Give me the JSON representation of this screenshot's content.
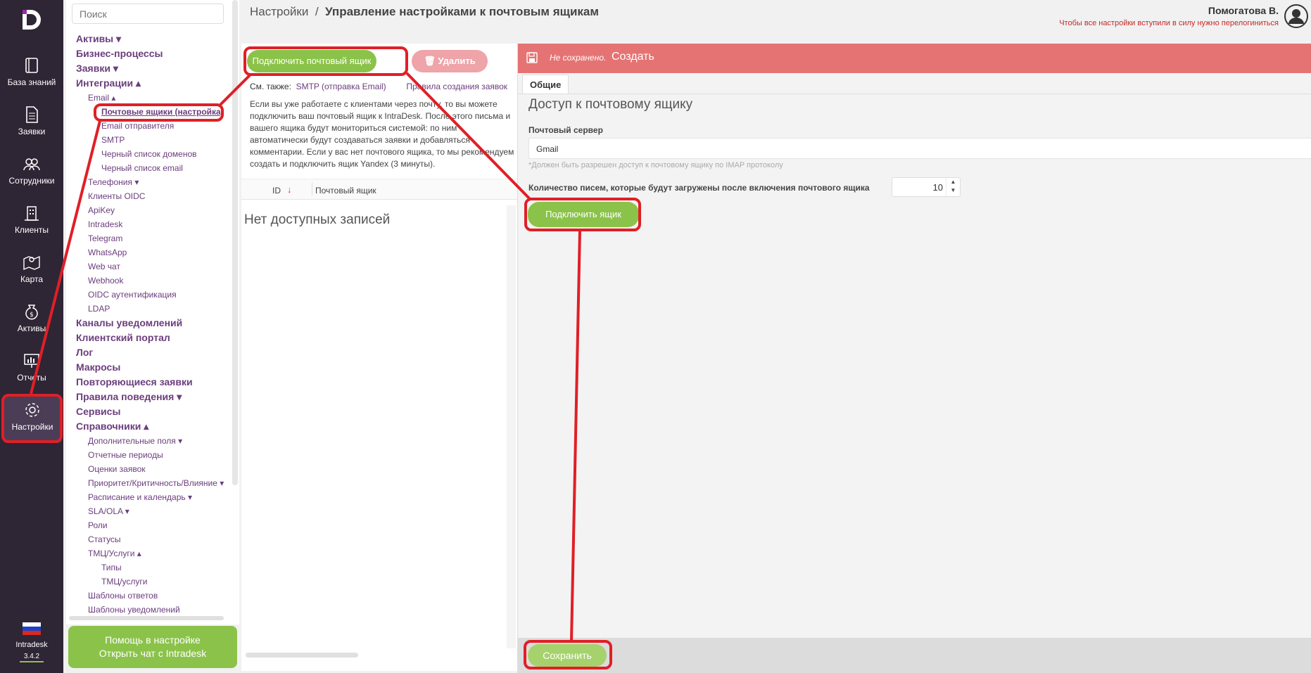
{
  "rail": {
    "items": [
      {
        "label": "База знаний",
        "icon": "book-icon"
      },
      {
        "label": "Заявки",
        "icon": "document-icon"
      },
      {
        "label": "Сотрудники",
        "icon": "users-icon"
      },
      {
        "label": "Клиенты",
        "icon": "building-icon"
      },
      {
        "label": "Карта",
        "icon": "map-icon"
      },
      {
        "label": "Активы",
        "icon": "money-bag-icon"
      },
      {
        "label": "Отчеты",
        "icon": "chart-icon"
      },
      {
        "label": "Настройки",
        "icon": "gear-icon"
      }
    ],
    "app_name": "Intradesk",
    "version": "3.4.2"
  },
  "nav": {
    "search_placeholder": "Поиск",
    "items": [
      {
        "label": "Активы ▾",
        "level": 1
      },
      {
        "label": "Бизнес-процессы",
        "level": 1
      },
      {
        "label": "Заявки ▾",
        "level": 1
      },
      {
        "label": "Интеграции ▴",
        "level": 1
      },
      {
        "label": "Email ▴",
        "level": 2
      },
      {
        "label": "Почтовые ящики (настройка)",
        "level": 3
      },
      {
        "label": "Email отправителя",
        "level": 3
      },
      {
        "label": "SMTP",
        "level": 3
      },
      {
        "label": "Черный список доменов",
        "level": 3
      },
      {
        "label": "Черный список email",
        "level": 3
      },
      {
        "label": "Телефония ▾",
        "level": 2
      },
      {
        "label": "Клиенты OIDC",
        "level": 2
      },
      {
        "label": "ApiKey",
        "level": 2
      },
      {
        "label": "Intradesk",
        "level": 2
      },
      {
        "label": "Telegram",
        "level": 2
      },
      {
        "label": "WhatsApp",
        "level": 2
      },
      {
        "label": "Web чат",
        "level": 2
      },
      {
        "label": "Webhook",
        "level": 2
      },
      {
        "label": "OIDC аутентификация",
        "level": 2
      },
      {
        "label": "LDAP",
        "level": 2
      },
      {
        "label": "Каналы уведомлений",
        "level": 1
      },
      {
        "label": "Клиентский портал",
        "level": 1
      },
      {
        "label": "Лог",
        "level": 1
      },
      {
        "label": "Макросы",
        "level": 1
      },
      {
        "label": "Повторяющиеся заявки",
        "level": 1
      },
      {
        "label": "Правила поведения ▾",
        "level": 1
      },
      {
        "label": "Сервисы",
        "level": 1
      },
      {
        "label": "Справочники ▴",
        "level": 1
      },
      {
        "label": "Дополнительные поля ▾",
        "level": 2
      },
      {
        "label": "Отчетные периоды",
        "level": 2
      },
      {
        "label": "Оценки заявок",
        "level": 2
      },
      {
        "label": "Приоритет/Критичность/Влияние ▾",
        "level": 2
      },
      {
        "label": "Расписание и календарь ▾",
        "level": 2
      },
      {
        "label": "SLA/OLA ▾",
        "level": 2
      },
      {
        "label": "Роли",
        "level": 2
      },
      {
        "label": "Статусы",
        "level": 2
      },
      {
        "label": "ТМЦ/Услуги ▴",
        "level": 2
      },
      {
        "label": "Типы",
        "level": 3
      },
      {
        "label": "ТМЦ/услуги",
        "level": 3
      },
      {
        "label": "Шаблоны ответов",
        "level": 2
      },
      {
        "label": "Шаблоны уведомлений",
        "level": 2
      }
    ],
    "help_line1": "Помощь в настройке",
    "help_line2": "Открыть чат с Intradesk"
  },
  "header": {
    "crumb_root": "Настройки",
    "crumb_sep": "/",
    "crumb_current": "Управление настройками к почтовым ящикам",
    "user_name": "Помогатова В.",
    "warning": "Чтобы все настройки вступили в силу нужно перелогиниться"
  },
  "list": {
    "connect_label": "Подключить почтовый ящик",
    "delete_label": "Удалить",
    "see_also": "См. также:",
    "link_smtp": "SMTP (отправка Email)",
    "link_rules": "Правила создания заявок",
    "intro": "Если вы уже работаете с клиентами через почту, то вы можете подключить ваш почтовый ящик к IntraDesk. После этого письма и вашего ящика будут мониториться системой: по ним автоматически будут создаваться заявки и добавляться комментарии. Если у вас нет почтового ящика, то мы рекомендуем создать и подключить ящик Yandex (3 минуты).",
    "col_id": "ID",
    "col_mailbox": "Почтовый ящик",
    "empty_text": "Нет доступных записей"
  },
  "form": {
    "status": "Не сохранено.",
    "mode": "Создать",
    "tab_general": "Общие",
    "section_title": "Доступ к почтовому ящику",
    "server_label": "Почтовый сервер",
    "server_value": "Gmail",
    "server_hint": "*Должен быть разрешен доступ к почтовому ящику по IMAP протоколу",
    "count_label": "Количество писем, которые будут загружены после включения почтового ящика",
    "count_value": "10",
    "connect_box_label": "Подключить ящик",
    "save_label": "Сохранить"
  },
  "colors": {
    "accent_green": "#8bc34a",
    "rail_bg": "#2e2535",
    "nav_link": "#6b3d7d",
    "form_bar": "#e57373",
    "annotation_red": "#e01f26"
  }
}
